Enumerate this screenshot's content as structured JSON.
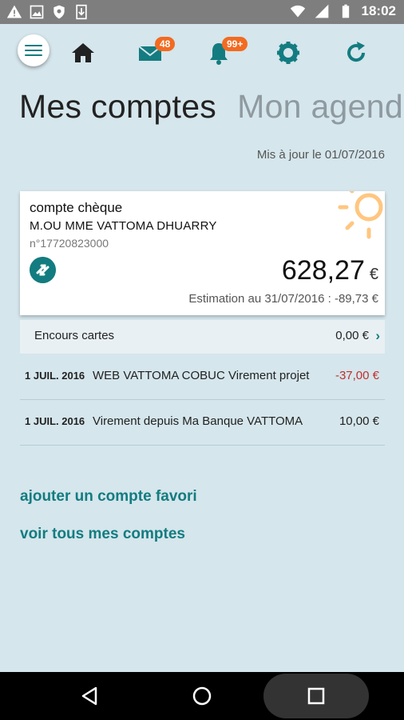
{
  "status_bar": {
    "time": "18:02",
    "icons_left": [
      "warning-icon",
      "image-icon",
      "shield-icon",
      "download-icon"
    ],
    "icons_right": [
      "wifi-icon",
      "signal-icon",
      "battery-icon"
    ]
  },
  "appbar": {
    "messages_badge": "48",
    "notifications_badge": "99+",
    "icons": [
      "menu-icon",
      "home-icon",
      "mail-icon",
      "bell-icon",
      "gear-icon",
      "refresh-icon"
    ]
  },
  "colors": {
    "accent": "#137c80",
    "badge": "#f26b21",
    "negative": "#c0302e",
    "background": "#d5e6ec"
  },
  "tabs": {
    "active": "Mes comptes",
    "inactive": "Mon agenda"
  },
  "updated": "Mis à jour le 01/07/2016",
  "account": {
    "type": "compte chèque",
    "holder": "M.OU MME VATTOMA DHUARRY",
    "number": "n°17720823000",
    "balance": "628,27",
    "currency": "€",
    "estimate": "Estimation au 31/07/2016 : -89,73 €"
  },
  "encours": {
    "label": "Encours cartes",
    "value": "0,00 €"
  },
  "transactions": [
    {
      "date": "1 JUIL. 2016",
      "label": "WEB VATTOMA COBUC Virement projet",
      "amount": "-37,00 €"
    },
    {
      "date": "1 JUIL. 2016",
      "label": "Virement depuis Ma Banque VATTOMA",
      "amount": "10,00 €"
    }
  ],
  "links": {
    "add_favorite": "ajouter un compte favori",
    "all_accounts": "voir tous mes comptes"
  },
  "navbar": [
    "back-icon",
    "home-circle-icon",
    "recents-icon"
  ]
}
